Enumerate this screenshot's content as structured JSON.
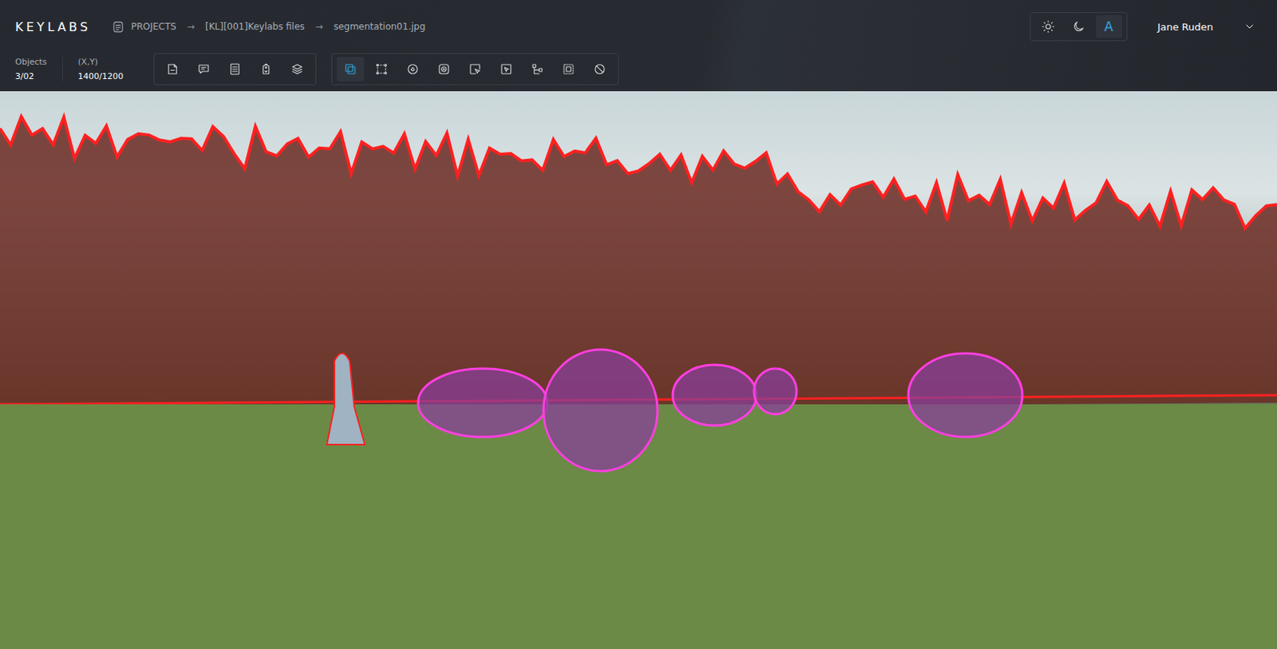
{
  "app": {
    "logo": "KEYLABS"
  },
  "breadcrumb": {
    "items": [
      {
        "label": "PROJECTS"
      },
      {
        "label": "[KL][001]Keylabs files"
      },
      {
        "label": "segmentation01.jpg"
      }
    ],
    "separator": "→"
  },
  "theme_buttons": [
    {
      "kind": "icon",
      "selected": false
    },
    {
      "kind": "icon",
      "selected": false
    },
    {
      "kind": "text",
      "label": "A",
      "selected": true
    }
  ],
  "user": {
    "name": "Jane Ruden"
  },
  "stats": [
    {
      "label": "Objects",
      "value": "3/02"
    },
    {
      "label": "(X,Y)",
      "value": "1400/1200"
    }
  ],
  "toolbars": [
    {
      "tools": [
        {
          "selected": false
        },
        {
          "selected": false
        },
        {
          "selected": false
        },
        {
          "selected": false
        },
        {
          "selected": false
        }
      ]
    },
    {
      "tools": [
        {
          "selected": true
        },
        {
          "selected": false
        },
        {
          "selected": false
        },
        {
          "selected": false
        },
        {
          "selected": false
        },
        {
          "selected": false
        },
        {
          "selected": false
        },
        {
          "selected": false
        },
        {
          "selected": false
        }
      ]
    }
  ]
}
